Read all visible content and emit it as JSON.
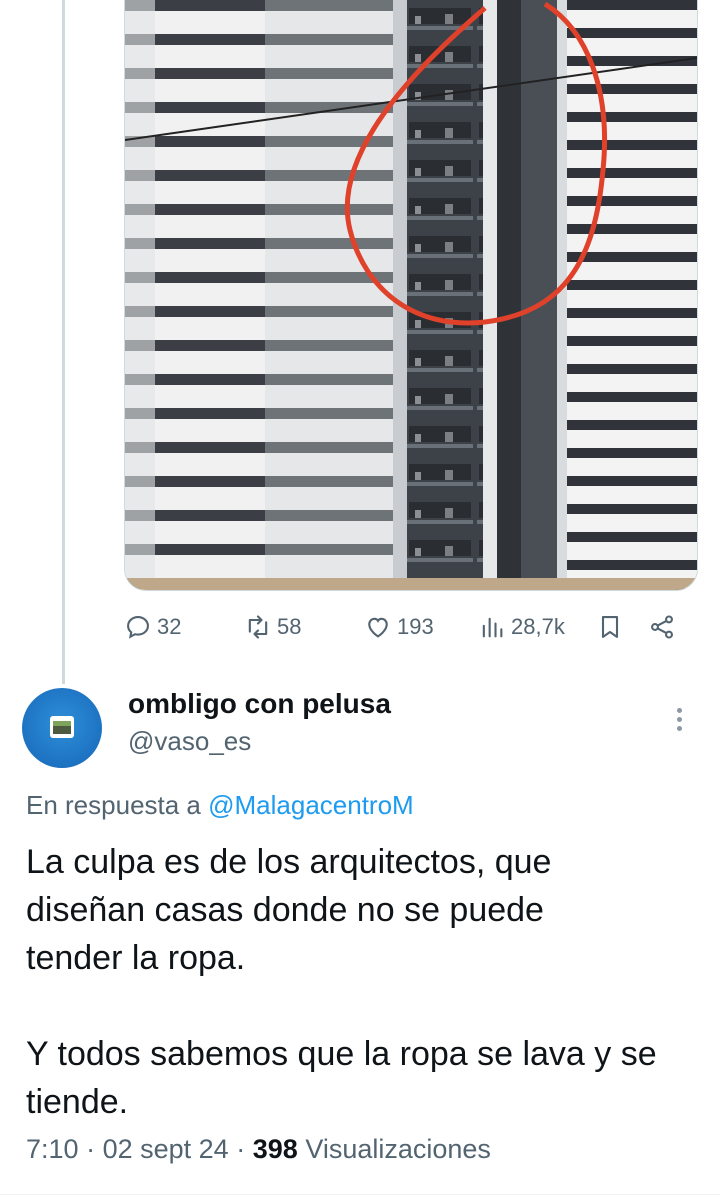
{
  "metrics": {
    "replies": "32",
    "retweets": "58",
    "likes": "193",
    "views": "28,7k"
  },
  "reply": {
    "author_name": "ombligo con pelusa",
    "author_handle": "@vaso_es",
    "in_reply_prefix": "En respuesta a",
    "in_reply_handle": "@MalagacentroM",
    "text": "La culpa es de los arquitectos,  que\ndiseñan casas donde no se puede\ntender la ropa.\n\nY todos sabemos que la ropa se lava y se\ntiende.",
    "time": "7:10",
    "sep1": "·",
    "date": "02 sept 24",
    "sep2": "·",
    "view_count": "398",
    "view_label": "Visualizaciones"
  },
  "icons": {
    "reply": "reply-icon",
    "retweet": "retweet-icon",
    "like": "heart-icon",
    "views": "views-bar-icon",
    "bookmark": "bookmark-icon",
    "share": "share-icon",
    "more": "more-vertical-icon"
  },
  "colors": {
    "accent": "#1d9bf0",
    "secondary_text": "#536471",
    "annotation_circle": "#e0412a"
  }
}
